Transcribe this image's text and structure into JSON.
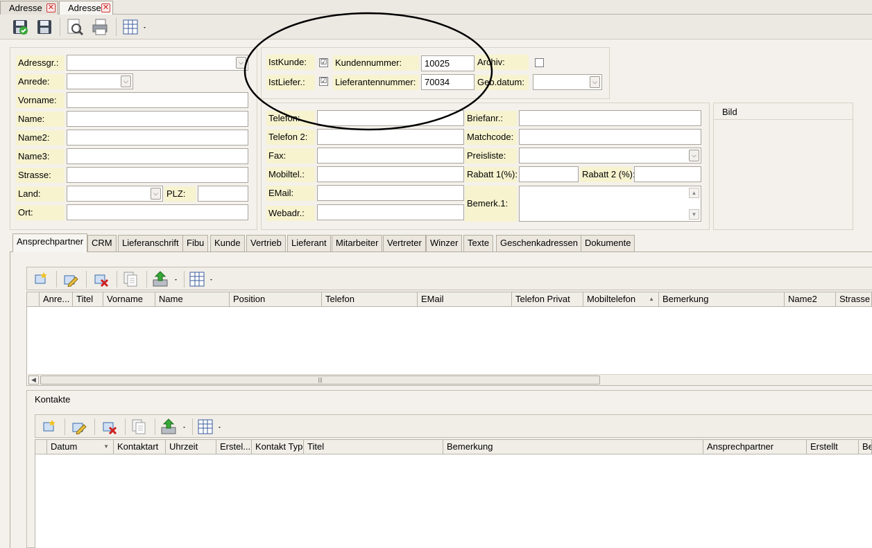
{
  "doc_tabs": [
    {
      "label": "Adresse",
      "active": false
    },
    {
      "label": "Adresse",
      "active": true
    }
  ],
  "toolbar": {
    "icons": [
      "save-close-icon",
      "save-icon",
      "preview-icon",
      "print-icon",
      "grid-layout-icon"
    ]
  },
  "left_form": {
    "adressgr_label": "Adressgr.:",
    "adressgr_value": "",
    "anrede_label": "Anrede:",
    "anrede_value": "",
    "vorname_label": "Vorname:",
    "vorname_value": "",
    "name_label": "Name:",
    "name_value": "",
    "name2_label": "Name2:",
    "name2_value": "",
    "name3_label": "Name3:",
    "name3_value": "",
    "strasse_label": "Strasse:",
    "strasse_value": "",
    "land_label": "Land:",
    "land_value": "",
    "plz_label": "PLZ:",
    "plz_value": "",
    "ort_label": "Ort:",
    "ort_value": ""
  },
  "top_form": {
    "istkunde_label": "IstKunde:",
    "istkunde_checked": "☑",
    "kundennummer_label": "Kundennummer:",
    "kundennummer_value": "10025",
    "archiv_label": "Archiv:",
    "istliefer_label": "IstLiefer.:",
    "lieferantennummer_label": "Lieferantennummer:",
    "lieferantennummer_value": "70034",
    "gebdatum_label": "Geb.datum:",
    "gebdatum_value": ""
  },
  "mid_form": {
    "telefon_label": "Telefon:",
    "telefon2_label": "Telefon 2:",
    "fax_label": "Fax:",
    "mobiltel_label": "Mobiltel.:",
    "email_label": "EMail:",
    "webadr_label": "Webadr.:",
    "briefanr_label": "Briefanr.:",
    "matchcode_label": "Matchcode:",
    "preisliste_label": "Preisliste:",
    "rabatt1_label": "Rabatt 1(%):",
    "rabatt2_label": "Rabatt 2 (%):",
    "bemerk1_label": "Bemerk.1:"
  },
  "bild": {
    "title": "Bild"
  },
  "sub_tabs": [
    "Ansprechpartner",
    "CRM",
    "Lieferanschrift",
    "Fibu",
    "Kunde",
    "Vertrieb",
    "Lieferant",
    "Mitarbeiter",
    "Vertreter",
    "Winzer",
    "Texte",
    "Geschenkadressen",
    "Dokumente"
  ],
  "contacts_grid": {
    "columns": [
      "Anre...",
      "Titel",
      "Vorname",
      "Name",
      "Position",
      "Telefon",
      "EMail",
      "Telefon Privat",
      "Mobiltelefon",
      "Bemerkung",
      "Name2",
      "Strasse"
    ],
    "rows": []
  },
  "kontakte": {
    "title": "Kontakte",
    "columns": [
      "Datum",
      "Kontaktart",
      "Uhrzeit",
      "Erstel...",
      "Kontakt Typ",
      "Titel",
      "Bemerkung",
      "Ansprechpartner",
      "Erstellt",
      "Be"
    ],
    "rows": []
  },
  "colors": {
    "label_bg": "#f7f3cf",
    "panel_bg": "#f4f1ec",
    "ellipse": "#000000"
  }
}
